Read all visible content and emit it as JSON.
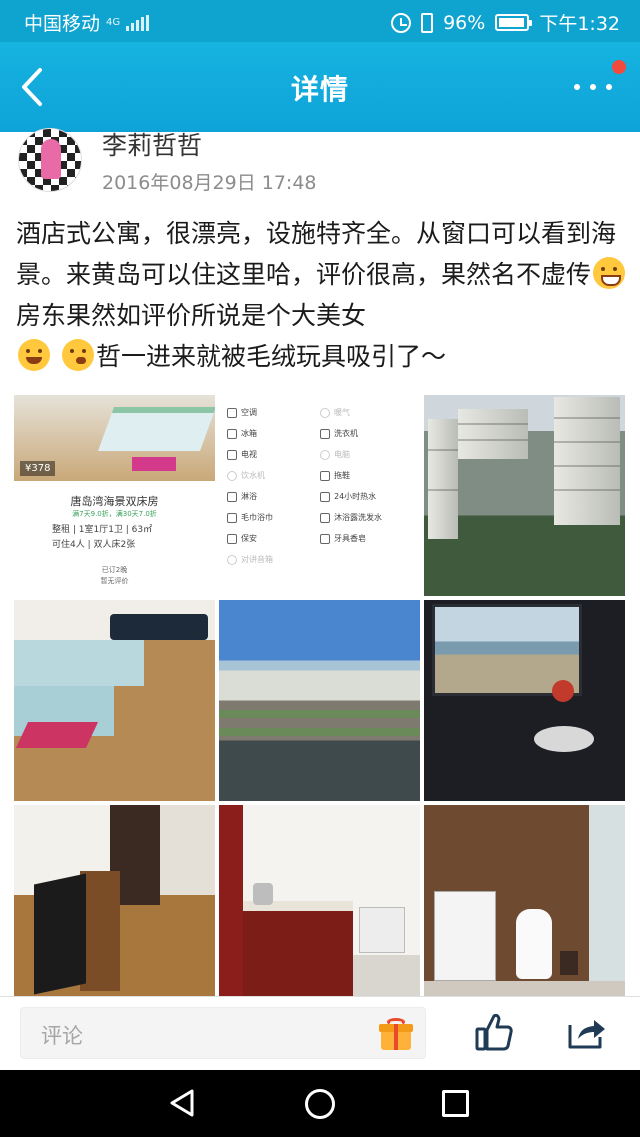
{
  "status_bar": {
    "carrier": "中国移动",
    "network": "4G",
    "battery_percent": "96%",
    "time": "下午1:32",
    "battery_level": 0.96
  },
  "nav": {
    "title": "详情",
    "back_icon": "chevron-left-icon",
    "more_icon": "more-dots-icon",
    "notification_dot_color": "#f24a3c"
  },
  "post": {
    "author": "李莉哲哲",
    "timestamp": "2016年08月29日 17:48",
    "text_parts": {
      "p1": "酒店式公寓，很漂亮，设施特齐全。从窗口可以看到海景。来黄岛可以住这里哈，评价很高，果然名不虚传",
      "p2": "房东果然如评价所说是个大美女",
      "p3": "哲一进来就被毛绒玩具吸引了～"
    },
    "emojis": [
      "grin-emoji",
      "smile-emoji",
      "thinking-emoji"
    ]
  },
  "photos": {
    "listing": {
      "price": "¥378",
      "title": "唐岛湾海景双床房",
      "subtitle": "满7天9.0折，满30天7.0折",
      "info_line1": "整租 | 1室1厅1卫 | 63㎡",
      "info_line2": "可住4人 | 双人床2张",
      "stat_line1": "已订2晚",
      "stat_line2": "暂无评价"
    },
    "amenities": [
      {
        "label": "空调",
        "available": true
      },
      {
        "label": "暖气",
        "available": false
      },
      {
        "label": "冰箱",
        "available": true
      },
      {
        "label": "洗衣机",
        "available": true
      },
      {
        "label": "电视",
        "available": true
      },
      {
        "label": "电脑",
        "available": false
      },
      {
        "label": "饮水机",
        "available": false
      },
      {
        "label": "拖鞋",
        "available": true
      },
      {
        "label": "淋浴",
        "available": true
      },
      {
        "label": "24小时热水",
        "available": true
      },
      {
        "label": "毛巾浴巾",
        "available": true
      },
      {
        "label": "沐浴露洗发水",
        "available": true
      },
      {
        "label": "保安",
        "available": true
      },
      {
        "label": "牙具香皂",
        "available": true
      },
      {
        "label": "对讲音箱",
        "available": false
      }
    ],
    "photo_names": [
      "listing-card-photo",
      "amenities-screenshot-photo",
      "residential-towers-photo",
      "bedroom-child-photo",
      "seaside-town-photo",
      "window-seaview-photo",
      "living-room-photo",
      "kitchen-photo",
      "bathroom-photo"
    ]
  },
  "bottom_bar": {
    "comment_placeholder": "评论",
    "gift_icon": "gift-icon",
    "like_icon": "thumbs-up-icon",
    "share_icon": "share-icon"
  },
  "colors": {
    "accent": "#0fa3cf",
    "nav_gradient_top": "#16b3e0"
  }
}
